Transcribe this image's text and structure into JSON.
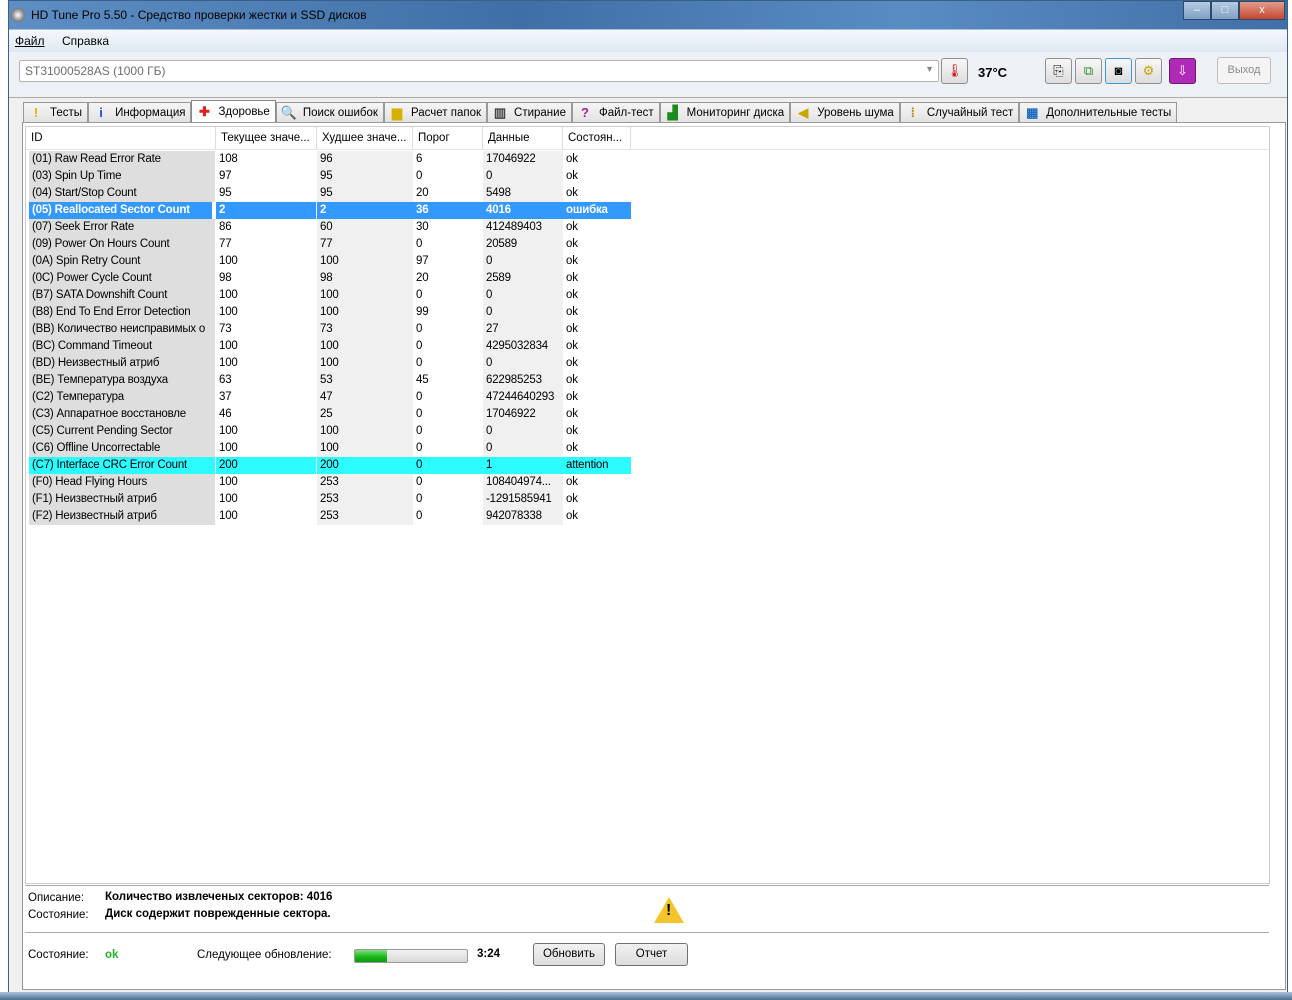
{
  "window": {
    "title": "HD Tune Pro 5.50 - Средство проверки жестки и SSD дисков",
    "minimize": "–",
    "maximize": "□",
    "close": "x"
  },
  "menu": [
    "Файл",
    "Справка"
  ],
  "toolbar": {
    "drive": "ST31000528AS (1000 ГБ)",
    "temperature": "37°C",
    "exit": "Выход"
  },
  "tabs": [
    {
      "label": "Тесты",
      "icon": "exclamation-icon",
      "glyph": "!",
      "color": "#d8b400"
    },
    {
      "label": "Информация",
      "icon": "info-icon",
      "glyph": "i",
      "color": "#1d4fcf"
    },
    {
      "label": "Здоровье",
      "icon": "health-cross-icon",
      "glyph": "✚",
      "color": "#e0201c"
    },
    {
      "label": "Поиск ошибок",
      "icon": "magnifier-icon",
      "glyph": "🔍",
      "color": "#2a9a2a"
    },
    {
      "label": "Расчет папок",
      "icon": "folder-icon",
      "glyph": "▆",
      "color": "#d7b000"
    },
    {
      "label": "Стирание",
      "icon": "trash-icon",
      "glyph": "▥",
      "color": "#444"
    },
    {
      "label": "Файл-тест",
      "icon": "file-test-icon",
      "glyph": "?",
      "color": "#a020a0"
    },
    {
      "label": "Мониторинг диска",
      "icon": "bar-chart-icon",
      "glyph": "▟",
      "color": "#1a8a1a"
    },
    {
      "label": "Уровень шума",
      "icon": "speaker-icon",
      "glyph": "◀",
      "color": "#c8a800"
    },
    {
      "label": "Случайный тест",
      "icon": "scatter-icon",
      "glyph": "⁞",
      "color": "#c08000"
    },
    {
      "label": "Дополнительные тесты",
      "icon": "extra-tests-icon",
      "glyph": "▦",
      "color": "#1a6ac0"
    }
  ],
  "columns": [
    "ID",
    "Текущее значе...",
    "Худшее значе...",
    "Порог",
    "Данные",
    "Состоян..."
  ],
  "rows": [
    [
      "(01) Raw Read Error Rate",
      "108",
      "96",
      "6",
      "17046922",
      "ok"
    ],
    [
      "(03) Spin Up Time",
      "97",
      "95",
      "0",
      "0",
      "ok"
    ],
    [
      "(04) Start/Stop Count",
      "95",
      "95",
      "20",
      "5498",
      "ok"
    ],
    [
      "(05) Reallocated Sector Count",
      "2",
      "2",
      "36",
      "4016",
      "ошибка"
    ],
    [
      "(07) Seek Error Rate",
      "86",
      "60",
      "30",
      "412489403",
      "ok"
    ],
    [
      "(09) Power On Hours Count",
      "77",
      "77",
      "0",
      "20589",
      "ok"
    ],
    [
      "(0A) Spin Retry Count",
      "100",
      "100",
      "97",
      "0",
      "ok"
    ],
    [
      "(0C) Power Cycle Count",
      "98",
      "98",
      "20",
      "2589",
      "ok"
    ],
    [
      "(B7) SATA Downshift Count",
      "100",
      "100",
      "0",
      "0",
      "ok"
    ],
    [
      "(B8) End To End Error Detection",
      "100",
      "100",
      "99",
      "0",
      "ok"
    ],
    [
      "(BB) Количество неисправимых о",
      "73",
      "73",
      "0",
      "27",
      "ok"
    ],
    [
      "(BC) Command Timeout",
      "100",
      "100",
      "0",
      "4295032834",
      "ok"
    ],
    [
      "(BD) Неизвестный атриб",
      "100",
      "100",
      "0",
      "0",
      "ok"
    ],
    [
      "(BE) Температура воздуха",
      "63",
      "53",
      "45",
      "622985253",
      "ok"
    ],
    [
      "(C2) Температура",
      "37",
      "47",
      "0",
      "47244640293",
      "ok"
    ],
    [
      "(C3) Аппаратное восстановле",
      "46",
      "25",
      "0",
      "17046922",
      "ok"
    ],
    [
      "(C5) Current Pending Sector",
      "100",
      "100",
      "0",
      "0",
      "ok"
    ],
    [
      "(C6) Offline Uncorrectable",
      "100",
      "100",
      "0",
      "0",
      "ok"
    ],
    [
      "(C7) Interface CRC Error Count",
      "200",
      "200",
      "0",
      "1",
      "attention"
    ],
    [
      "(F0) Head Flying Hours",
      "100",
      "253",
      "0",
      "108404974...",
      "ok"
    ],
    [
      "(F1) Неизвестный атриб",
      "100",
      "253",
      "0",
      "-1291585941",
      "ok"
    ],
    [
      "(F2) Неизвестный атриб",
      "100",
      "253",
      "0",
      "942078338",
      "ok"
    ]
  ],
  "details": {
    "desc_label": "Описание:",
    "desc_value": "Количество извлеченых секторов: 4016",
    "state_label": "Состояние:",
    "state_value": "Диск содержит поврежденные сектора."
  },
  "footer": {
    "status_label": "Состояние:",
    "status_value": "ok",
    "next_label": "Следующее обновление:",
    "progress": 0.29,
    "countdown": "3:24",
    "refresh": "Обновить",
    "report": "Отчет"
  }
}
